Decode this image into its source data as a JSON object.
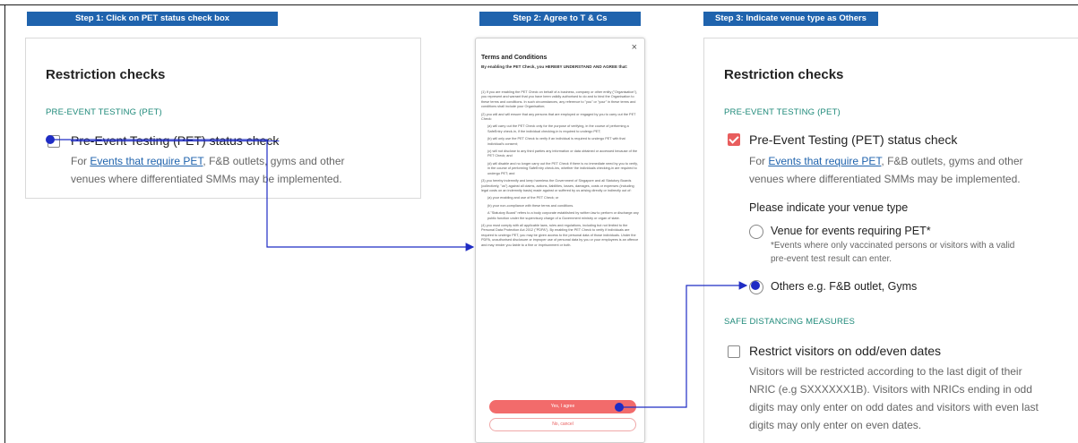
{
  "steps": [
    {
      "label": "Step 1: Click on PET status check box"
    },
    {
      "label": "Step 2: Agree to T & Cs"
    },
    {
      "label": "Step 3: Indicate venue type as Others"
    }
  ],
  "restriction_panel": {
    "title": "Restriction checks",
    "pet_section_label": "PRE-EVENT TESTING (PET)",
    "pet_check_label": "Pre-Event Testing (PET) status check",
    "pet_desc_prefix": "For ",
    "pet_desc_link": "Events that require PET",
    "pet_desc_line1_suffix": ", F&B outlets, gyms and other",
    "pet_desc_line2": "venues where differentiated SMMs may be implemented."
  },
  "panel_step3": {
    "venue_prompt": "Please indicate your venue type",
    "venue_option1": "Venue for events requiring PET*",
    "venue_note_line1": "*Events where only vaccinated persons or visitors with a valid",
    "venue_note_line2": "pre-event test result can enter.",
    "venue_option2": "Others e.g. F&B outlet, Gyms",
    "sdm_section_label": "SAFE DISTANCING MEASURES",
    "sdm_check_label": "Restrict visitors on odd/even dates",
    "sdm_desc_lines": [
      "Visitors will be restricted according to the last digit of their",
      "NRIC (e.g SXXXXXX1B).  Visitors with NRICs ending in odd",
      "digits may only enter on odd dates and visitors with even last",
      "digits may only enter on even dates."
    ]
  },
  "terms_modal": {
    "close": "×",
    "title": "Terms and Conditions",
    "intro": "By enabling the PET Check, you HEREBY UNDERSTAND AND AGREE that:",
    "paragraphs": [
      "(1) If you are enabling the PET Check on behalf of a business, company or other entity (\"Organisation\"), you represent and warrant that you have been validly authorised to do and to bind the Organisation to these terms and conditions. In such circumstances, any reference to \"you\" or \"your\" in these terms and conditions shall include your Organisation;",
      "(2) you will and will ensure that any persons that are employed or engaged by you to carry out the PET Check:",
      "(a) will carry out the PET Check only for the purpose of verifying, in the course of performing a SafeEntry check-in, if the individual checking-in is required to undergo PET;",
      "(b) will only use the PET Check to verify if an individual is required to undergo PET with that individual's consent;",
      "(c) will not disclose to any third parties any information or data obtained or accessed because of the PET Check; and",
      "(d) will disable and no longer carry out the PET Check if there is no immediate need by you to verify, in the course of performing SafeEntry check-ins, whether the individuals checking-in are required to undergo PET; and",
      "(3) you hereby indemnify and keep harmless the Government of Singapore and all Statutory Boards (collectively, \"us\") against all claims, actions, liabilities, losses, damages, costs or expenses (including legal costs on an indemnity basis) made against or suffered by us arising directly or indirectly out of:",
      "(a) your enabling and use of the PET Check; or",
      "(b) your non-compliance with these terms and conditions.",
      "A \"Statutory Board\" refers to a body corporate established by written law to perform or discharge any public function under the supervisory charge of a Government ministry or organ of state.",
      "(4) you must comply with all applicable laws, rules and regulations, including but not limited to the Personal Data Protection Act 2012 (\"PDPA\"). By enabling the PET Check to verify if individuals are required to undergo PET, you may be given access to the personal data of those individuals. Under the PDPA, unauthorised disclosure or improper use of personal data by you or your employees is an offence and may render you liable to a fine or imprisonment or both."
    ],
    "agree_label": "Yes, I agree",
    "cancel_label": "No, cancel"
  },
  "colors": {
    "banner": "#1f63ad",
    "accent_red": "#e85d5d",
    "section_teal": "#1f8a7a",
    "arrow_blue": "#1f2cc4"
  }
}
